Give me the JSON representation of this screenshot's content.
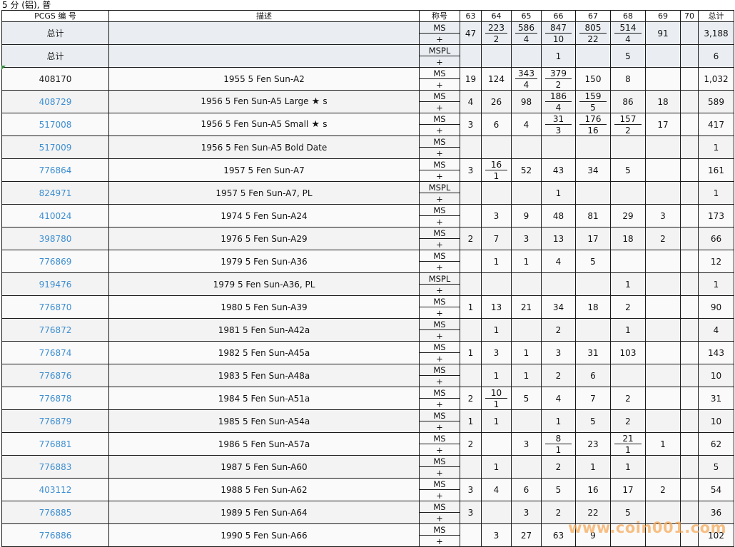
{
  "sheet_title": "5 分 (铝), 普",
  "watermark": "www.coin001.com",
  "headers": {
    "pcgs": "PCGS 编 号",
    "desc": "描述",
    "grade": "称号",
    "grades": [
      "63",
      "64",
      "65",
      "66",
      "67",
      "68",
      "69",
      "70"
    ],
    "total": "总计"
  },
  "rows": [
    {
      "pcgs": "总计",
      "link": false,
      "desc": "",
      "designation": "MS",
      "total_row": true,
      "vals": [
        {
          "v": "47"
        },
        {
          "t": "223",
          "b": "2"
        },
        {
          "t": "586",
          "b": "4"
        },
        {
          "t": "847",
          "b": "10"
        },
        {
          "t": "805",
          "b": "22"
        },
        {
          "t": "514",
          "b": "4"
        },
        {
          "v": "91"
        },
        {
          "v": ""
        }
      ],
      "total": "3,188"
    },
    {
      "pcgs": "总计",
      "link": false,
      "desc": "",
      "designation": "MSPL",
      "total_row": true,
      "vals": [
        {
          "v": ""
        },
        {
          "v": ""
        },
        {
          "v": ""
        },
        {
          "v": "1"
        },
        {
          "v": ""
        },
        {
          "v": "5"
        },
        {
          "v": ""
        },
        {
          "v": ""
        }
      ],
      "total": "6"
    },
    {
      "pcgs": "408170",
      "link": false,
      "desc": "1955 5 Fen Sun-A2",
      "designation": "MS",
      "vals": [
        {
          "v": "19"
        },
        {
          "v": "124"
        },
        {
          "t": "343",
          "b": "4"
        },
        {
          "t": "379",
          "b": "2"
        },
        {
          "v": "150"
        },
        {
          "v": "8"
        },
        {
          "v": ""
        },
        {
          "v": ""
        }
      ],
      "total": "1,032"
    },
    {
      "pcgs": "408729",
      "link": true,
      "desc": "1956 5 Fen Sun-A5 Large",
      "star": true,
      "desc_suffix": "s",
      "designation": "MS",
      "vals": [
        {
          "v": "4"
        },
        {
          "v": "26"
        },
        {
          "v": "98"
        },
        {
          "t": "186",
          "b": "4"
        },
        {
          "t": "159",
          "b": "5"
        },
        {
          "v": "86"
        },
        {
          "v": "18"
        },
        {
          "v": ""
        }
      ],
      "total": "589"
    },
    {
      "pcgs": "517008",
      "link": true,
      "desc": "1956 5 Fen Sun-A5 Small",
      "star": true,
      "desc_suffix": "s",
      "designation": "MS",
      "vals": [
        {
          "v": "3"
        },
        {
          "v": "6"
        },
        {
          "v": "4"
        },
        {
          "t": "31",
          "b": "3"
        },
        {
          "t": "176",
          "b": "16"
        },
        {
          "t": "157",
          "b": "2"
        },
        {
          "v": "17"
        },
        {
          "v": ""
        }
      ],
      "total": "417"
    },
    {
      "pcgs": "517009",
      "link": true,
      "desc": "1956 5 Fen Sun-A5 Bold Date",
      "designation": "MS",
      "vals": [
        {
          "v": ""
        },
        {
          "v": ""
        },
        {
          "v": ""
        },
        {
          "v": ""
        },
        {
          "v": ""
        },
        {
          "v": ""
        },
        {
          "v": ""
        },
        {
          "v": ""
        }
      ],
      "total": "1"
    },
    {
      "pcgs": "776864",
      "link": true,
      "desc": "1957 5 Fen Sun-A7",
      "designation": "MS",
      "vals": [
        {
          "v": "3"
        },
        {
          "t": "16",
          "b": "1"
        },
        {
          "v": "52"
        },
        {
          "v": "43"
        },
        {
          "v": "34"
        },
        {
          "v": "5"
        },
        {
          "v": ""
        },
        {
          "v": ""
        }
      ],
      "total": "161"
    },
    {
      "pcgs": "824971",
      "link": true,
      "desc": "1957 5 Fen Sun-A7, PL",
      "designation": "MSPL",
      "vals": [
        {
          "v": ""
        },
        {
          "v": ""
        },
        {
          "v": ""
        },
        {
          "v": "1"
        },
        {
          "v": ""
        },
        {
          "v": ""
        },
        {
          "v": ""
        },
        {
          "v": ""
        }
      ],
      "total": "1"
    },
    {
      "pcgs": "410024",
      "link": true,
      "desc": "1974 5 Fen Sun-A24",
      "designation": "MS",
      "vals": [
        {
          "v": ""
        },
        {
          "v": "3"
        },
        {
          "v": "9"
        },
        {
          "v": "48"
        },
        {
          "v": "81"
        },
        {
          "v": "29"
        },
        {
          "v": "3"
        },
        {
          "v": ""
        }
      ],
      "total": "173"
    },
    {
      "pcgs": "398780",
      "link": true,
      "desc": "1976 5 Fen Sun-A29",
      "designation": "MS",
      "vals": [
        {
          "v": "2"
        },
        {
          "v": "7"
        },
        {
          "v": "3"
        },
        {
          "v": "13"
        },
        {
          "v": "17"
        },
        {
          "v": "18"
        },
        {
          "v": "2"
        },
        {
          "v": ""
        }
      ],
      "total": "66"
    },
    {
      "pcgs": "776869",
      "link": true,
      "desc": "1979 5 Fen Sun-A36",
      "designation": "MS",
      "vals": [
        {
          "v": ""
        },
        {
          "v": "1"
        },
        {
          "v": "1"
        },
        {
          "v": "4"
        },
        {
          "v": "5"
        },
        {
          "v": ""
        },
        {
          "v": ""
        },
        {
          "v": ""
        }
      ],
      "total": "12"
    },
    {
      "pcgs": "919476",
      "link": true,
      "desc": "1979 5 Fen Sun-A36, PL",
      "designation": "MSPL",
      "vals": [
        {
          "v": ""
        },
        {
          "v": ""
        },
        {
          "v": ""
        },
        {
          "v": ""
        },
        {
          "v": ""
        },
        {
          "v": "1"
        },
        {
          "v": ""
        },
        {
          "v": ""
        }
      ],
      "total": "1"
    },
    {
      "pcgs": "776870",
      "link": true,
      "desc": "1980 5 Fen Sun-A39",
      "designation": "MS",
      "vals": [
        {
          "v": "1"
        },
        {
          "v": "13"
        },
        {
          "v": "21"
        },
        {
          "v": "34"
        },
        {
          "v": "18"
        },
        {
          "v": "2"
        },
        {
          "v": ""
        },
        {
          "v": ""
        }
      ],
      "total": "90"
    },
    {
      "pcgs": "776872",
      "link": true,
      "desc": "1981 5 Fen Sun-A42a",
      "designation": "MS",
      "vals": [
        {
          "v": ""
        },
        {
          "v": "1"
        },
        {
          "v": ""
        },
        {
          "v": "2"
        },
        {
          "v": ""
        },
        {
          "v": "1"
        },
        {
          "v": ""
        },
        {
          "v": ""
        }
      ],
      "total": "4"
    },
    {
      "pcgs": "776874",
      "link": true,
      "desc": "1982 5 Fen Sun-A45a",
      "designation": "MS",
      "vals": [
        {
          "v": "1"
        },
        {
          "v": "3"
        },
        {
          "v": "1"
        },
        {
          "v": "3"
        },
        {
          "v": "31"
        },
        {
          "v": "103"
        },
        {
          "v": ""
        },
        {
          "v": ""
        }
      ],
      "total": "143"
    },
    {
      "pcgs": "776876",
      "link": true,
      "desc": "1983 5 Fen Sun-A48a",
      "designation": "MS",
      "vals": [
        {
          "v": ""
        },
        {
          "v": "1"
        },
        {
          "v": "1"
        },
        {
          "v": "2"
        },
        {
          "v": "6"
        },
        {
          "v": ""
        },
        {
          "v": ""
        },
        {
          "v": ""
        }
      ],
      "total": "10"
    },
    {
      "pcgs": "776878",
      "link": true,
      "desc": "1984 5 Fen Sun-A51a",
      "designation": "MS",
      "vals": [
        {
          "v": "2"
        },
        {
          "t": "10",
          "b": "1"
        },
        {
          "v": "5"
        },
        {
          "v": "4"
        },
        {
          "v": "7"
        },
        {
          "v": "2"
        },
        {
          "v": ""
        },
        {
          "v": ""
        }
      ],
      "total": "31"
    },
    {
      "pcgs": "776879",
      "link": true,
      "desc": "1985 5 Fen Sun-A54a",
      "designation": "MS",
      "vals": [
        {
          "v": "1"
        },
        {
          "v": "1"
        },
        {
          "v": ""
        },
        {
          "v": "1"
        },
        {
          "v": "5"
        },
        {
          "v": "2"
        },
        {
          "v": ""
        },
        {
          "v": ""
        }
      ],
      "total": "10"
    },
    {
      "pcgs": "776881",
      "link": true,
      "desc": "1986 5 Fen Sun-A57a",
      "designation": "MS",
      "vals": [
        {
          "v": "2"
        },
        {
          "v": ""
        },
        {
          "v": "3"
        },
        {
          "t": "8",
          "b": "1"
        },
        {
          "v": "23"
        },
        {
          "t": "21",
          "b": "1"
        },
        {
          "v": "1"
        },
        {
          "v": ""
        }
      ],
      "total": "62"
    },
    {
      "pcgs": "776883",
      "link": true,
      "desc": "1987 5 Fen Sun-A60",
      "designation": "MS",
      "vals": [
        {
          "v": ""
        },
        {
          "v": "1"
        },
        {
          "v": ""
        },
        {
          "v": "2"
        },
        {
          "v": "1"
        },
        {
          "v": "1"
        },
        {
          "v": ""
        },
        {
          "v": ""
        }
      ],
      "total": "5"
    },
    {
      "pcgs": "403112",
      "link": true,
      "desc": "1988 5 Fen Sun-A62",
      "designation": "MS",
      "vals": [
        {
          "v": "3"
        },
        {
          "v": "4"
        },
        {
          "v": "6"
        },
        {
          "v": "5"
        },
        {
          "v": "16"
        },
        {
          "v": "17"
        },
        {
          "v": "2"
        },
        {
          "v": ""
        }
      ],
      "total": "54"
    },
    {
      "pcgs": "776885",
      "link": true,
      "desc": "1989 5 Fen Sun-A64",
      "designation": "MS",
      "vals": [
        {
          "v": "3"
        },
        {
          "v": ""
        },
        {
          "v": "3"
        },
        {
          "v": "2"
        },
        {
          "v": "22"
        },
        {
          "v": "5"
        },
        {
          "v": ""
        },
        {
          "v": ""
        }
      ],
      "total": "36"
    },
    {
      "pcgs": "776886",
      "link": true,
      "desc": "1990 5 Fen Sun-A66",
      "designation": "MS",
      "vals": [
        {
          "v": ""
        },
        {
          "v": "3"
        },
        {
          "v": "27"
        },
        {
          "v": "63"
        },
        {
          "v": "9"
        },
        {
          "v": ""
        },
        {
          "v": ""
        },
        {
          "v": ""
        }
      ],
      "total": "102"
    }
  ],
  "plus_label": "+"
}
